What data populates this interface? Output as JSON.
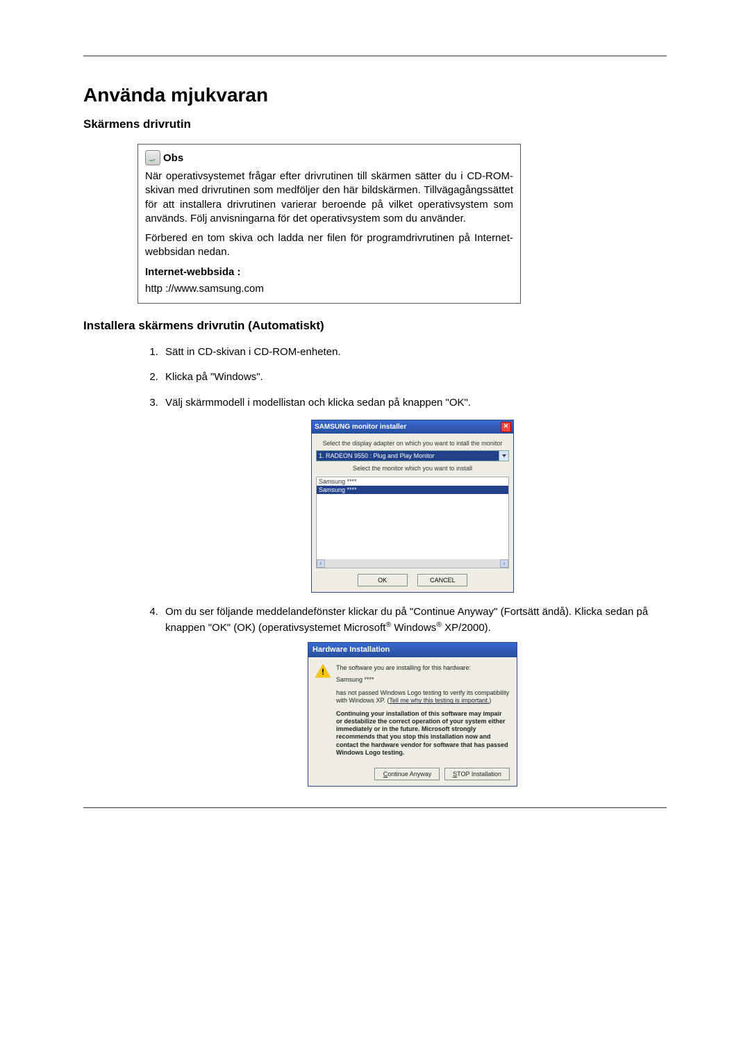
{
  "page": {
    "title": "Använda mjukvaran",
    "section": "Skärmens drivrutin"
  },
  "obs": {
    "heading": "Obs",
    "p1": "När operativsystemet frågar efter drivrutinen till skärmen sätter du i CD-ROM-skivan med drivrutinen som medföljer den här bildskärmen. Tillvägagångssättet för att installera drivrutinen varierar beroende på vilket operativsystem som används. Följ anvisningarna för det operativsystem som du använder.",
    "p2": "Förbered en tom skiva och ladda ner filen för programdrivrutinen på Internet-webbsidan nedan.",
    "internet_label": "Internet-webbsida :",
    "url": "http ://www.samsung.com"
  },
  "install": {
    "heading": "Installera skärmens drivrutin (Automatiskt)",
    "steps": {
      "s1": "Sätt in CD-skivan i CD-ROM-enheten.",
      "s2": "Klicka på \"Windows\".",
      "s3": "Välj skärmmodell i modellistan och klicka sedan på knappen \"OK\".",
      "s4a": "Om du ser följande meddelandefönster klickar du på \"Continue Anyway\" (Fortsätt ändå). Klicka sedan på knappen \"OK\" (OK) (operativsystemet Microsoft",
      "s4b": " Windows",
      "s4c": " XP/2000)."
    }
  },
  "installer_dialog": {
    "title": "SAMSUNG monitor installer",
    "close": "✕",
    "line1": "Select the display adapter on which you want to intall the monitor",
    "adapter": "1. RADEON 9550 : Plug and Play Monitor",
    "line2": "Select the monitor which you want to install",
    "list_item1": "Samsung ****",
    "list_item2": "Samsung ****",
    "scroll_left": "‹",
    "scroll_right": "›",
    "ok": "OK",
    "cancel": "CANCEL"
  },
  "hw_dialog": {
    "title": "Hardware Installation",
    "bang": "!",
    "line1": "The software you are installing for this hardware:",
    "name": "Samsung ****",
    "pass1": "has not passed Windows Logo testing to verify its compatibility with Windows XP. (",
    "pass_link": "Tell me why this testing is important.",
    "pass2": ")",
    "bold": "Continuing your installation of this software may impair or destabilize the correct operation of your system either immediately or in the future. Microsoft strongly recommends that you stop this installation now and contact the hardware vendor for software that has passed Windows Logo testing.",
    "btn_continue_u": "C",
    "btn_continue_rest": "ontinue Anyway",
    "btn_stop_u": "S",
    "btn_stop_rest": "TOP Installation"
  }
}
